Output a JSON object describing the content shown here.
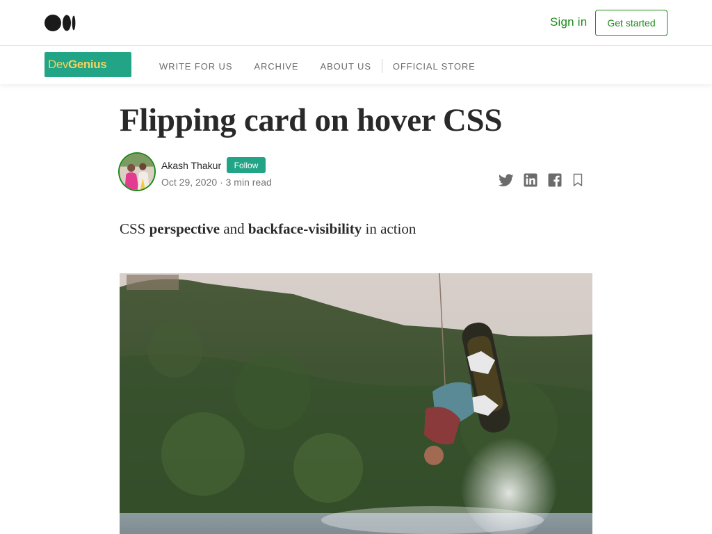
{
  "topbar": {
    "logo_icon": "medium-logo-icon",
    "sign_in": "Sign in",
    "get_started": "Get started"
  },
  "publication": {
    "logo_dev": "Dev",
    "logo_genius": "Genius",
    "nav": [
      "WRITE FOR US",
      "ARCHIVE",
      "ABOUT US",
      "OFFICIAL STORE"
    ]
  },
  "article": {
    "title": "Flipping card on hover CSS",
    "author": "Akash Thakur",
    "follow_label": "Follow",
    "date": "Oct 29, 2020",
    "separator": "·",
    "read_time": "3 min read",
    "subtitle": {
      "t1": "CSS ",
      "b1": "perspective",
      "t2": " and ",
      "b2": "backface-visibility",
      "t3": " in action"
    }
  },
  "share": {
    "icons": [
      "twitter-icon",
      "linkedin-icon",
      "facebook-icon",
      "bookmark-icon"
    ]
  },
  "colors": {
    "accent_green": "#1a8917",
    "publication_teal": "#22a587",
    "logo_yellow": "#f4d35e"
  }
}
